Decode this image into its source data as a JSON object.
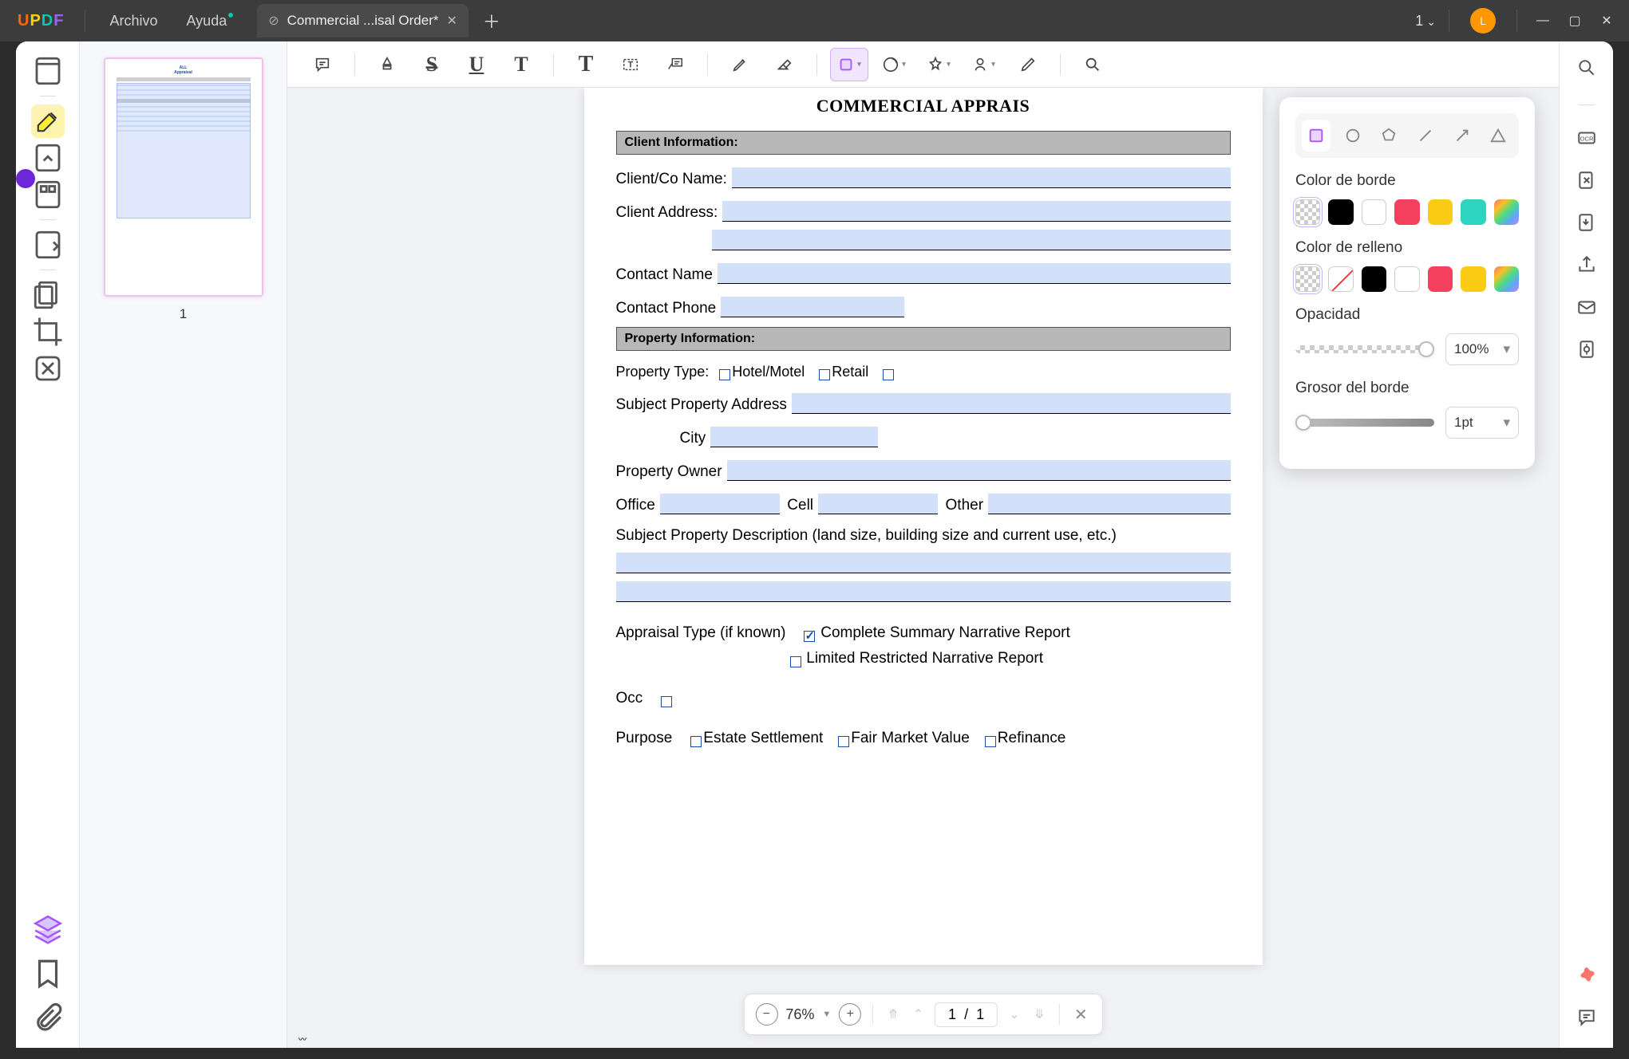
{
  "titlebar": {
    "logo": "UPDF",
    "menu_file": "Archivo",
    "menu_help": "Ayuda",
    "tab_title": "Commercial ...isal Order*",
    "page_indicator": "1",
    "user_initial": "L"
  },
  "thumbnail": {
    "page_number": "1"
  },
  "doc": {
    "title": "COMMERCIAL APPRAIS",
    "section_client": "Client Information:",
    "client_name": "Client/Co Name:",
    "client_address": "Client Address:",
    "contact_name": "Contact Name",
    "contact_phone": "Contact Phone",
    "section_property": "Property Information:",
    "property_type": "Property Type:",
    "pt_hotel": "Hotel/Motel",
    "pt_retail": "Retail",
    "subject_address": "Subject Property Address",
    "city": "City",
    "property_owner": "Property Owner",
    "office": "Office",
    "cell": "Cell",
    "other": "Other",
    "description": "Subject Property Description (land size, building size and current use, etc.)",
    "appraisal_type": "Appraisal Type (if known)",
    "complete_summary": "Complete Summary Narrative Report",
    "limited": "Limited Restricted Narrative Report",
    "occ": "Occ",
    "purpose": "Purpose",
    "p_estate": "Estate Settlement",
    "p_fmv": "Fair Market Value",
    "p_refi": "Refinance"
  },
  "shapepanel": {
    "border_color": "Color de borde",
    "fill_color": "Color de relleno",
    "opacity": "Opacidad",
    "opacity_val": "100%",
    "thickness": "Grosor del borde",
    "thickness_val": "1pt"
  },
  "zoombar": {
    "zoom": "76%",
    "page_current": "1",
    "page_total": "1"
  }
}
